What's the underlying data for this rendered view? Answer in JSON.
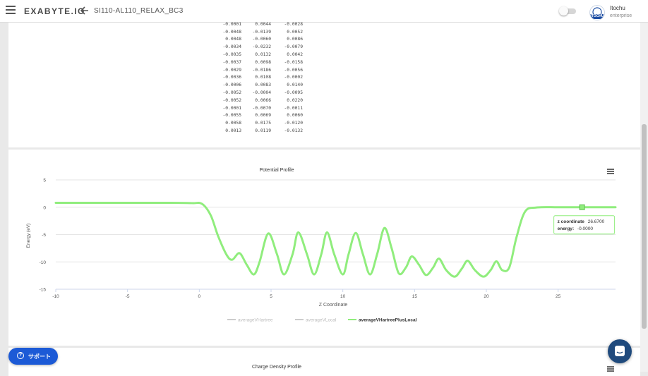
{
  "app": {
    "brand": "EXABYTE.IO",
    "job_name": "SI110-AL110_RELAX_BC3",
    "user_name": "Itochu",
    "user_org": "enterprise",
    "avatar_text": "ITOCHU"
  },
  "table_rows": [
    [
      "-0.0001",
      "0.0044",
      "-0.0028"
    ],
    [
      "-0.0048",
      "-0.0139",
      "0.0052"
    ],
    [
      "0.0048",
      "-0.0060",
      "0.0086"
    ],
    [
      "-0.0034",
      "-0.0232",
      "-0.0079"
    ],
    [
      "-0.0035",
      "0.0132",
      "0.0042"
    ],
    [
      "-0.0037",
      "0.0098",
      "-0.0158"
    ],
    [
      "-0.0029",
      "-0.0186",
      "-0.0056"
    ],
    [
      "-0.0036",
      "0.0108",
      "-0.0002"
    ],
    [
      "-0.0006",
      "0.0083",
      "0.0140"
    ],
    [
      "-0.0052",
      "-0.0004",
      "-0.0095"
    ],
    [
      "-0.0052",
      "0.0066",
      "0.0220"
    ],
    [
      "-0.0001",
      "-0.0070",
      "-0.0011"
    ],
    [
      "-0.0055",
      "0.0069",
      "0.0060"
    ],
    [
      "0.0058",
      "0.0175",
      "-0.0120"
    ],
    [
      "0.0013",
      "0.0119",
      "-0.0132"
    ]
  ],
  "chart_data": {
    "type": "line",
    "title": "Potential Profile",
    "xlabel": "Z Coordinate",
    "ylabel": "Energy (eV)",
    "xlim": [
      -10,
      29
    ],
    "ylim": [
      -15,
      5
    ],
    "xticks": [
      -10,
      -5,
      0,
      5,
      10,
      15,
      20,
      25
    ],
    "yticks": [
      5,
      0,
      -5,
      -10,
      -15
    ],
    "legend_position": "bottom",
    "grid": true,
    "series": [
      {
        "name": "averageVHartree",
        "visible": false,
        "color": "#cccccc",
        "points": []
      },
      {
        "name": "averageVLocal",
        "visible": false,
        "color": "#cccccc",
        "points": []
      },
      {
        "name": "averageVHartreePlusLocal",
        "visible": true,
        "color": "#90ed7d",
        "points": [
          [
            -10,
            0.8
          ],
          [
            -5,
            0.8
          ],
          [
            -2,
            0.8
          ],
          [
            -0.5,
            0.75
          ],
          [
            0.2,
            0.6
          ],
          [
            0.8,
            -1.5
          ],
          [
            1.3,
            -5.2
          ],
          [
            1.9,
            -8.7
          ],
          [
            2.3,
            -9.6
          ],
          [
            2.8,
            -8.4
          ],
          [
            3.3,
            -10.5
          ],
          [
            3.8,
            -12.3
          ],
          [
            4.2,
            -10.0
          ],
          [
            4.8,
            -4.8
          ],
          [
            5.4,
            -8.5
          ],
          [
            5.9,
            -12.3
          ],
          [
            6.5,
            -8.6
          ],
          [
            6.9,
            -4.6
          ],
          [
            7.5,
            -8.6
          ],
          [
            8.0,
            -12.3
          ],
          [
            8.5,
            -8.6
          ],
          [
            8.9,
            -4.6
          ],
          [
            9.4,
            -8.6
          ],
          [
            10.0,
            -12.3
          ],
          [
            10.4,
            -8.6
          ],
          [
            10.9,
            -4.7
          ],
          [
            11.4,
            -8.6
          ],
          [
            11.9,
            -12.3
          ],
          [
            12.4,
            -8.5
          ],
          [
            12.9,
            -3.8
          ],
          [
            13.4,
            -7.5
          ],
          [
            13.9,
            -12.1
          ],
          [
            14.4,
            -11.0
          ],
          [
            14.8,
            -9.0
          ],
          [
            15.3,
            -10.5
          ],
          [
            15.8,
            -12.4
          ],
          [
            16.3,
            -11.0
          ],
          [
            16.7,
            -9.4
          ],
          [
            17.2,
            -11.5
          ],
          [
            17.8,
            -12.7
          ],
          [
            18.3,
            -11.2
          ],
          [
            18.7,
            -9.8
          ],
          [
            19.2,
            -11.5
          ],
          [
            19.8,
            -12.7
          ],
          [
            20.3,
            -11.5
          ],
          [
            20.7,
            -9.9
          ],
          [
            21.1,
            -11.5
          ],
          [
            21.6,
            -11.0
          ],
          [
            22.1,
            -5.5
          ],
          [
            22.7,
            -0.8
          ],
          [
            23.5,
            -0.05
          ],
          [
            25,
            0
          ],
          [
            26.67,
            0
          ],
          [
            29,
            0
          ]
        ]
      }
    ],
    "tooltip": {
      "x": 26.67,
      "y": 0,
      "x_label": "z coordinate",
      "x_text": "26.6700",
      "y_label": "energy",
      "y_text": "-0.0000"
    },
    "next_title": "Charge Density Profile"
  }
}
